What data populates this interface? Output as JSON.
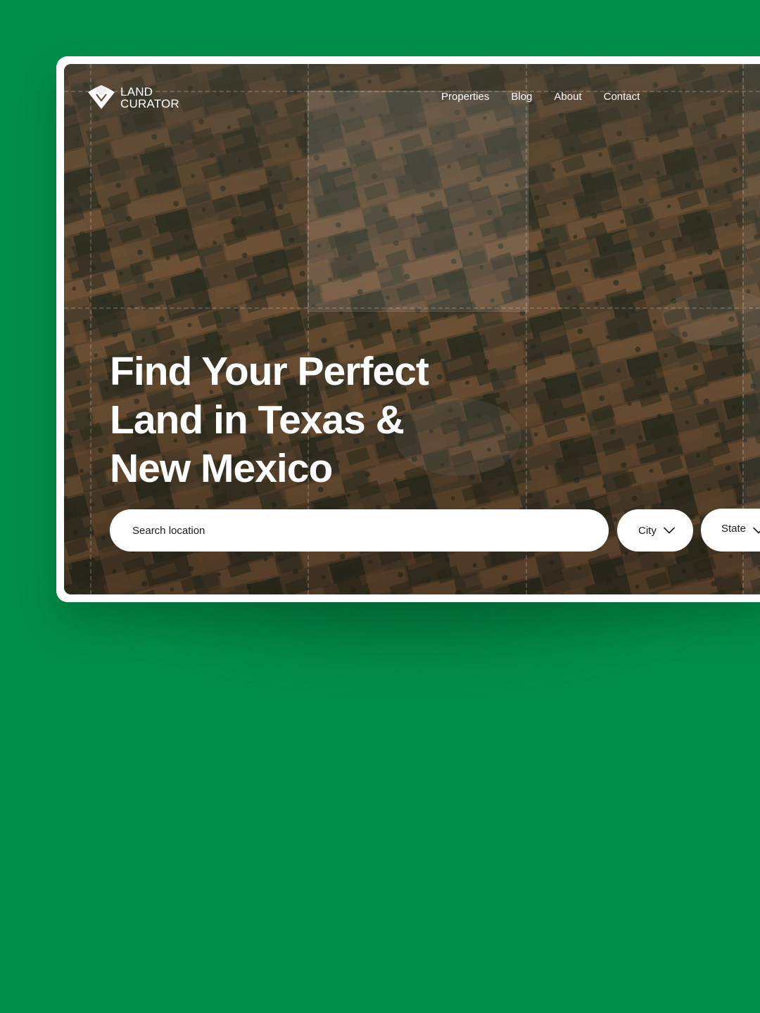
{
  "brand": {
    "line1": "LAND",
    "line2": "CURATOR",
    "icon": "land-curator-logo-icon"
  },
  "nav": {
    "items": [
      {
        "label": "Properties"
      },
      {
        "label": "Blog"
      },
      {
        "label": "About"
      },
      {
        "label": "Contact"
      }
    ]
  },
  "hero": {
    "headline_lines": [
      "Find Your Perfect",
      "Land in Texas &",
      "New Mexico"
    ]
  },
  "search": {
    "placeholder": "Search location",
    "value": "",
    "icon": "chevron-down-icon"
  },
  "filters": {
    "city": {
      "label": "City",
      "icon": "chevron-down-icon"
    },
    "state": {
      "label": "State",
      "icon": "chevron-down-icon"
    }
  },
  "colors": {
    "background": "#008f4a",
    "frame": "#ffffff",
    "text_on_hero": "#ffffff",
    "field_bg": "#ffffff",
    "field_text": "#1b1b1b"
  }
}
